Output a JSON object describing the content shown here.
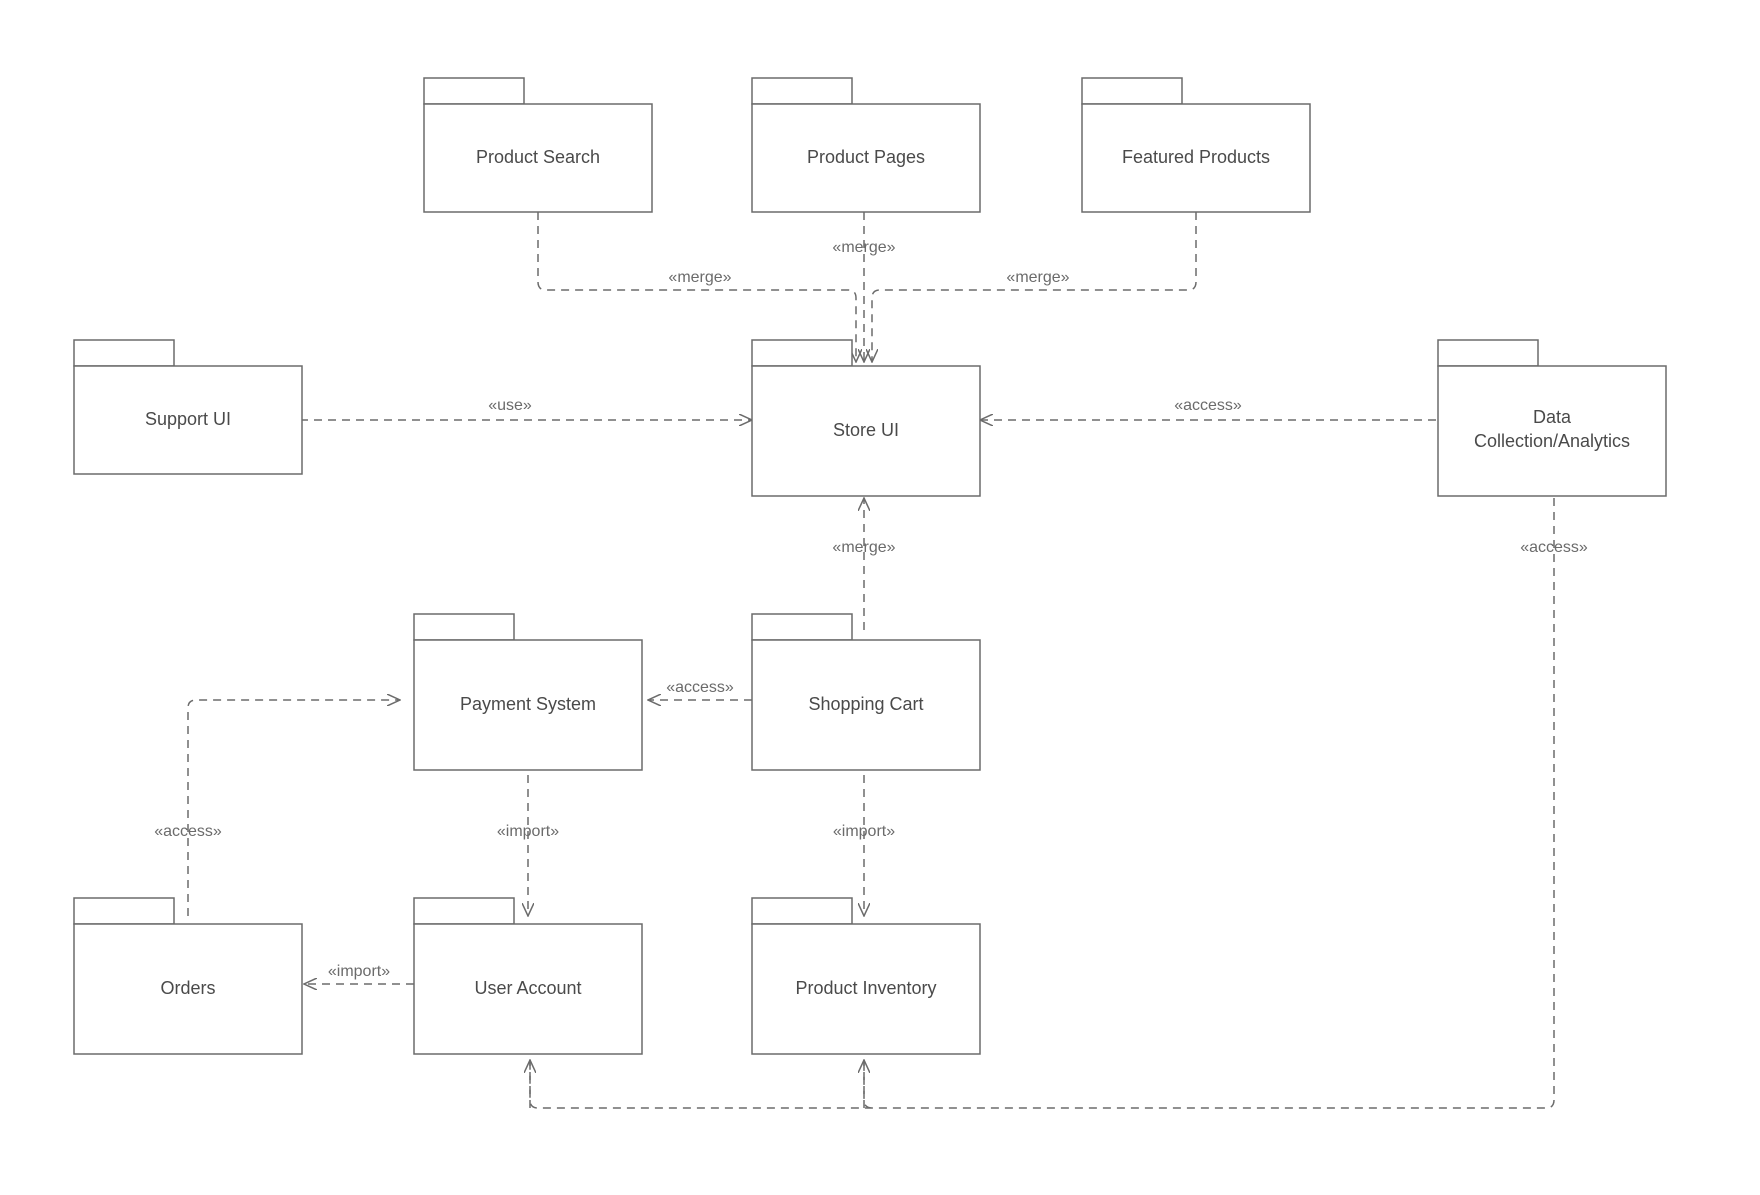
{
  "packages": {
    "product_search": {
      "label": "Product Search"
    },
    "product_pages": {
      "label": "Product Pages"
    },
    "featured_products": {
      "label": "Featured Products"
    },
    "support_ui": {
      "label": "Support UI"
    },
    "store_ui": {
      "label": "Store UI"
    },
    "data_analytics_l1": {
      "label": "Data"
    },
    "data_analytics_l2": {
      "label": "Collection/Analytics"
    },
    "payment_system": {
      "label": "Payment System"
    },
    "shopping_cart": {
      "label": "Shopping Cart"
    },
    "orders": {
      "label": "Orders"
    },
    "user_account": {
      "label": "User Account"
    },
    "product_inventory": {
      "label": "Product Inventory"
    }
  },
  "stereotypes": {
    "merge": "«merge»",
    "use": "«use»",
    "access": "«access»",
    "import": "«import»"
  }
}
